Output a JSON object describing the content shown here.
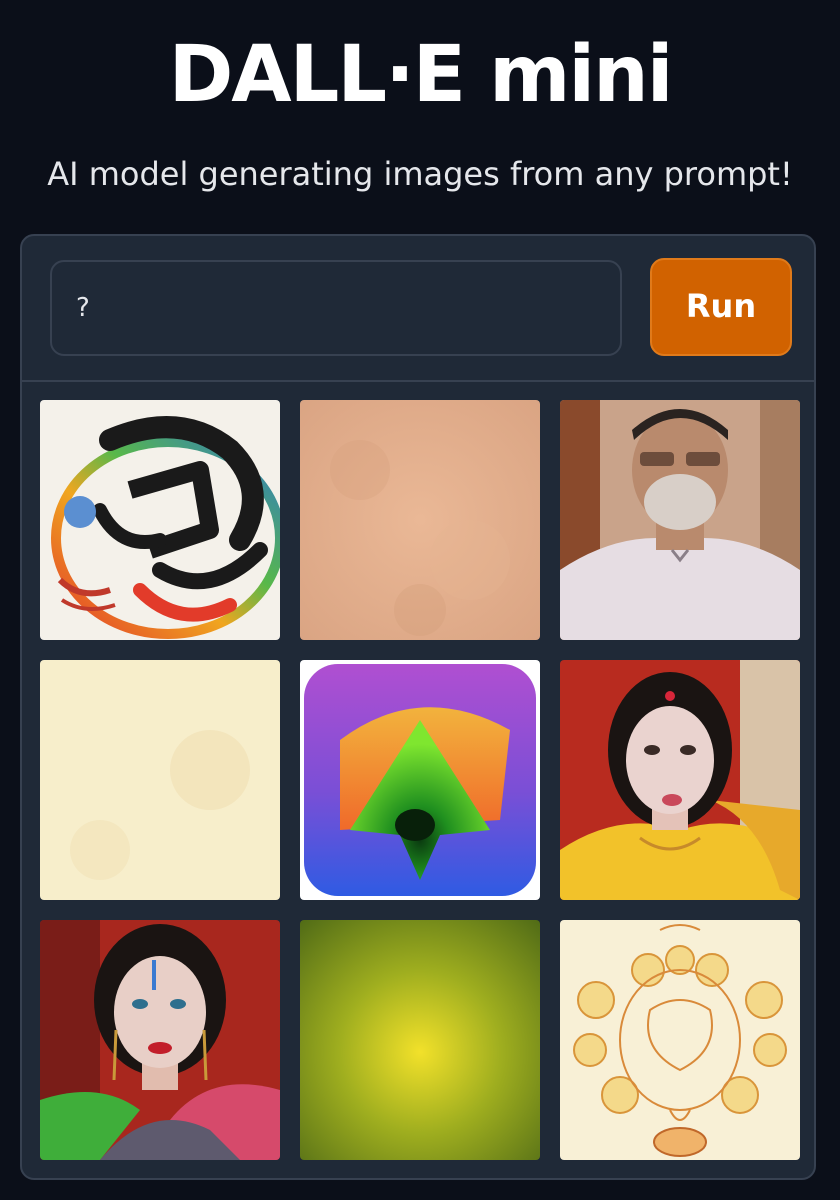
{
  "header": {
    "title": "DALL·E mini",
    "subtitle": "AI model generating images from any prompt!"
  },
  "prompt": {
    "value": "?"
  },
  "actions": {
    "run_label": "Run"
  },
  "gallery": {
    "images": [
      "abstract-calligraphy-image",
      "peach-texture-image",
      "man-portrait-image",
      "cream-paper-image",
      "gradient-icon-image",
      "woman-saree-portrait-image",
      "woman-portrait-image",
      "green-gradient-image",
      "ornament-drawing-image"
    ]
  },
  "colors": {
    "background": "#0b0f19",
    "panel": "#1f2937",
    "border": "#374151",
    "accent": "#d16200"
  }
}
